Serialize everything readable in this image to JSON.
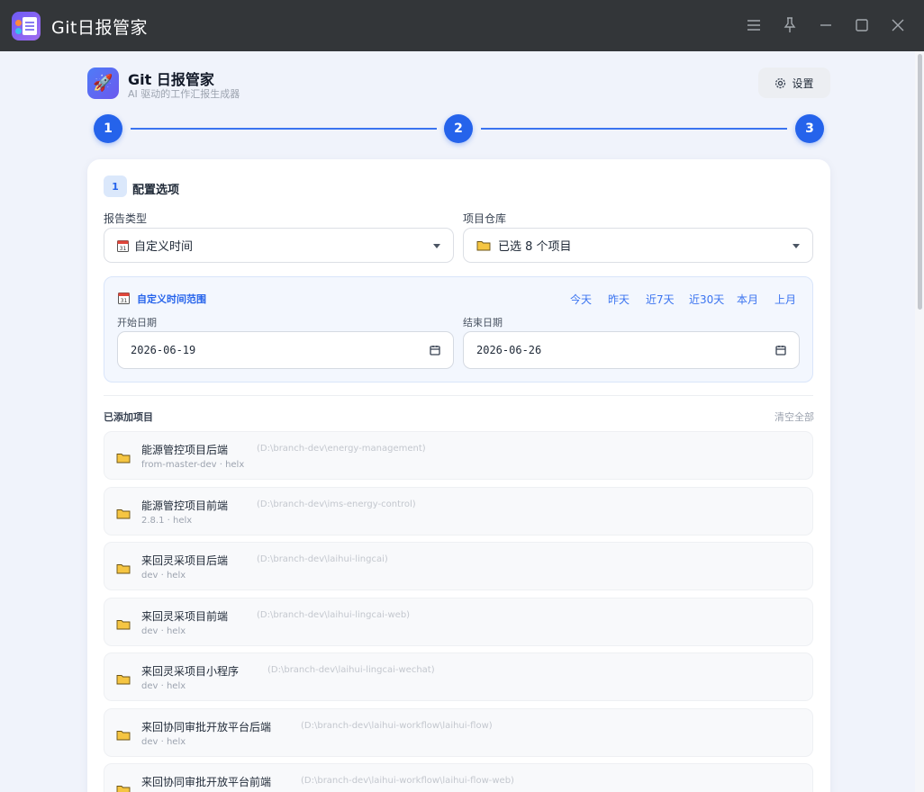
{
  "window": {
    "title": "Git日报管家"
  },
  "header": {
    "app_name": "Git 日报管家",
    "subtitle": "AI 驱动的工作汇报生成器",
    "settings_label": "设置"
  },
  "stepper": {
    "steps": [
      "1",
      "2",
      "3"
    ]
  },
  "config": {
    "section_number": "1",
    "section_title": "配置选项",
    "report_type_label": "报告类型",
    "report_type_value": "自定义时间",
    "repo_label": "项目仓库",
    "repo_value": "已选 8 个项目"
  },
  "range": {
    "title": "自定义时间范围",
    "quick": [
      "今天",
      "昨天",
      "近7天",
      "近30天",
      "本月",
      "上月"
    ],
    "start_label": "开始日期",
    "start_value": "2026-06-19",
    "end_label": "结束日期",
    "end_value": "2026-06-26"
  },
  "projects": {
    "title": "已添加项目",
    "clear_all": "清空全部",
    "items": [
      {
        "name": "能源管控项目后端",
        "path": "(D:\\branch-dev\\energy-management)",
        "meta": "from-master-dev · helx"
      },
      {
        "name": "能源管控项目前端",
        "path": "(D:\\branch-dev\\ims-energy-control)",
        "meta": "2.8.1 · helx"
      },
      {
        "name": "来回灵采项目后端",
        "path": "(D:\\branch-dev\\laihui-lingcai)",
        "meta": "dev · helx"
      },
      {
        "name": "来回灵采项目前端",
        "path": "(D:\\branch-dev\\laihui-lingcai-web)",
        "meta": "dev · helx"
      },
      {
        "name": "来回灵采项目小程序",
        "path": "(D:\\branch-dev\\laihui-lingcai-wechat)",
        "meta": "dev · helx"
      },
      {
        "name": "来回协同审批开放平台后端",
        "path": "(D:\\branch-dev\\laihui-workflow\\laihui-flow)",
        "meta": "dev · helx"
      },
      {
        "name": "来回协同审批开放平台前端",
        "path": "(D:\\branch-dev\\laihui-workflow\\laihui-flow-web)",
        "meta": ""
      }
    ]
  },
  "colors": {
    "accent": "#2563eb",
    "titlebar": "#333639",
    "background": "#f0f3fb"
  }
}
